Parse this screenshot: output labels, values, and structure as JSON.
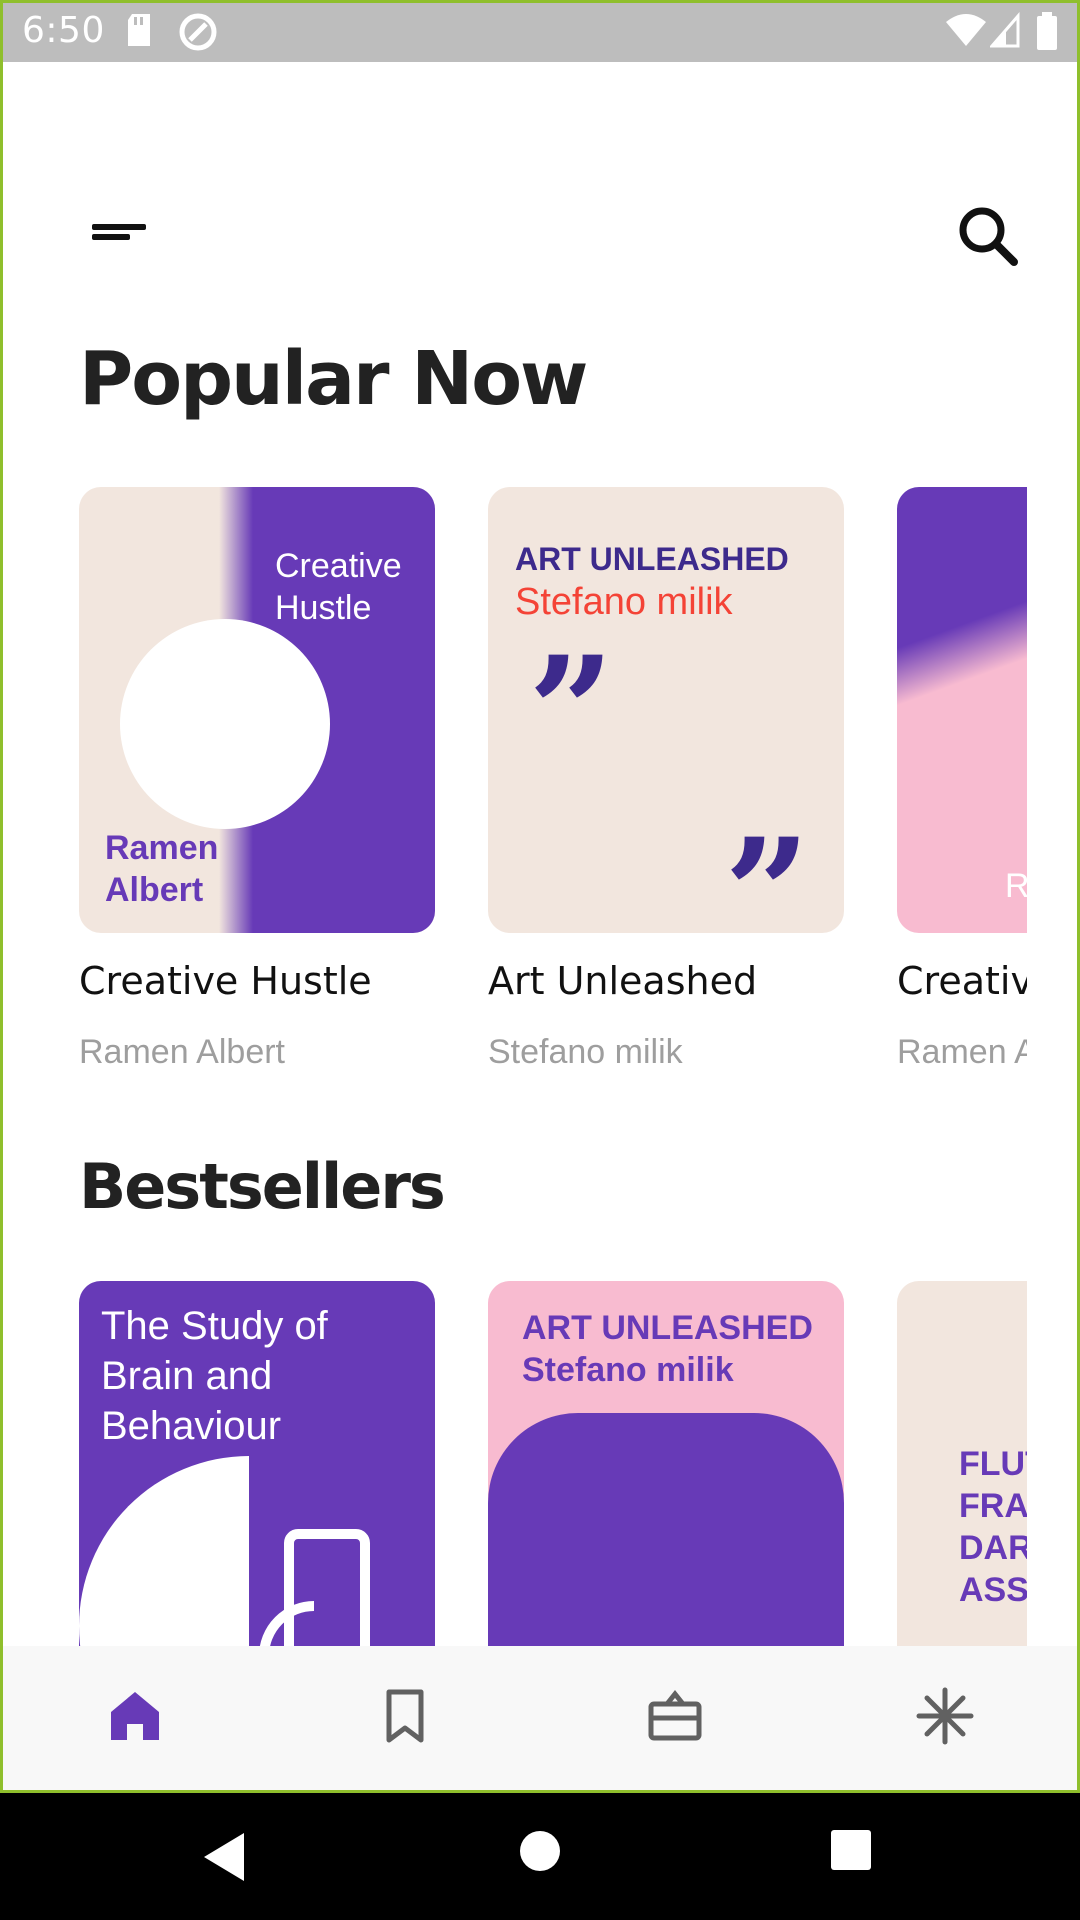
{
  "status_bar": {
    "time": "6:50"
  },
  "sections": {
    "popular_title": "Popular Now",
    "bestsellers_title": "Bestsellers"
  },
  "popular": [
    {
      "title": "Creative Hustle",
      "author": "Ramen Albert",
      "cover": {
        "title_line1": "Creative",
        "title_line2": "Hustle",
        "author_line1": "Ramen",
        "author_line2": "Albert"
      }
    },
    {
      "title": "Art Unleashed",
      "author": "Stefano milik",
      "cover": {
        "top": "ART UNLEASHED",
        "sub": "Stefano milik",
        "quote": "”"
      }
    },
    {
      "title": "Creative Hustle",
      "author": "Ramen Albert",
      "cover": {
        "letter": "R"
      }
    }
  ],
  "bestsellers": [
    {
      "cover": {
        "title_line1": "The Study of",
        "title_line2": "Brain and",
        "title_line3": "Behaviour"
      }
    },
    {
      "cover": {
        "line1": "ART UNLEASHED",
        "line2": "Stefano milik"
      }
    },
    {
      "cover": {
        "line1": "FLUTTER",
        "line2": "FRAMEWORK",
        "line3": "DART",
        "line4": "ASSETS"
      }
    }
  ],
  "colors": {
    "accent": "#673ab7",
    "cream": "#f2e6de",
    "pink": "#f8bbd0",
    "quote": "#3d2a8c",
    "red": "#f44336"
  },
  "bottom_nav": [
    {
      "icon": "home-icon",
      "active": true
    },
    {
      "icon": "bookmark-icon",
      "active": false
    },
    {
      "icon": "gift-card-icon",
      "active": false
    },
    {
      "icon": "snowflake-icon",
      "active": false
    }
  ]
}
